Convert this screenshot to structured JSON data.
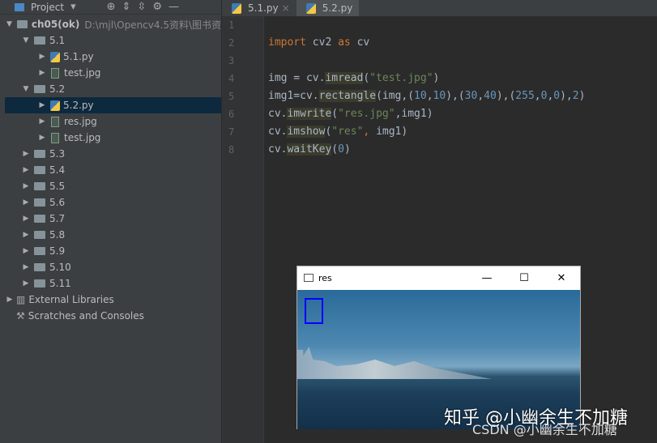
{
  "project_panel": {
    "title": "Project",
    "icons": [
      "locate-icon",
      "expand-all-icon",
      "collapse-all-icon",
      "gear-icon",
      "minimize-icon"
    ],
    "tree": [
      {
        "label": "ch05(ok)",
        "path": "D:\\mjl\\Opencv4.5资料\\图书资",
        "type": "folder",
        "depth": 0,
        "open": true
      },
      {
        "label": "5.1",
        "type": "folder",
        "depth": 1,
        "open": true
      },
      {
        "label": "5.1.py",
        "type": "py",
        "depth": 2
      },
      {
        "label": "test.jpg",
        "type": "jpg",
        "depth": 2
      },
      {
        "label": "5.2",
        "type": "folder",
        "depth": 1,
        "open": true
      },
      {
        "label": "5.2.py",
        "type": "py",
        "depth": 2,
        "selected": true
      },
      {
        "label": "res.jpg",
        "type": "jpg",
        "depth": 2
      },
      {
        "label": "test.jpg",
        "type": "jpg",
        "depth": 2
      },
      {
        "label": "5.3",
        "type": "folder",
        "depth": 1
      },
      {
        "label": "5.4",
        "type": "folder",
        "depth": 1
      },
      {
        "label": "5.5",
        "type": "folder",
        "depth": 1
      },
      {
        "label": "5.6",
        "type": "folder",
        "depth": 1
      },
      {
        "label": "5.7",
        "type": "folder",
        "depth": 1
      },
      {
        "label": "5.8",
        "type": "folder",
        "depth": 1
      },
      {
        "label": "5.9",
        "type": "folder",
        "depth": 1
      },
      {
        "label": "5.10",
        "type": "folder",
        "depth": 1
      },
      {
        "label": "5.11",
        "type": "folder",
        "depth": 1
      },
      {
        "label": "External Libraries",
        "type": "lib",
        "depth": 0
      },
      {
        "label": "Scratches and Consoles",
        "type": "scratch",
        "depth": 0,
        "noarrow": true
      }
    ]
  },
  "tabs": [
    {
      "label": "5.1.py",
      "active": false
    },
    {
      "label": "5.2.py",
      "active": true
    }
  ],
  "editor": {
    "lines": [
      [],
      [
        {
          "t": "import",
          "c": "kw"
        },
        {
          "t": " cv2 "
        },
        {
          "t": "as",
          "c": "kw"
        },
        {
          "t": " cv"
        }
      ],
      [],
      [
        {
          "t": "img = cv."
        },
        {
          "t": "imread",
          "c": "fn"
        },
        {
          "t": "("
        },
        {
          "t": "\"test.jpg\"",
          "c": "str"
        },
        {
          "t": ")"
        }
      ],
      [
        {
          "t": "img1=cv."
        },
        {
          "t": "rectangle",
          "c": "fn"
        },
        {
          "t": "(img,("
        },
        {
          "t": "10",
          "c": "num"
        },
        {
          "t": ","
        },
        {
          "t": "10",
          "c": "num"
        },
        {
          "t": "),("
        },
        {
          "t": "30",
          "c": "num"
        },
        {
          "t": ","
        },
        {
          "t": "40",
          "c": "num"
        },
        {
          "t": "),("
        },
        {
          "t": "255",
          "c": "num"
        },
        {
          "t": ","
        },
        {
          "t": "0",
          "c": "num"
        },
        {
          "t": ","
        },
        {
          "t": "0",
          "c": "num"
        },
        {
          "t": "),"
        },
        {
          "t": "2",
          "c": "num"
        },
        {
          "t": ")"
        }
      ],
      [
        {
          "t": "cv."
        },
        {
          "t": "imwrite",
          "c": "fn"
        },
        {
          "t": "("
        },
        {
          "t": "\"res.jpg\"",
          "c": "str"
        },
        {
          "t": ",img1)"
        }
      ],
      [
        {
          "t": "cv."
        },
        {
          "t": "imshow",
          "c": "fn"
        },
        {
          "t": "("
        },
        {
          "t": "\"res\"",
          "c": "str"
        },
        {
          "t": ", ",
          "c": "kw"
        },
        {
          "t": "img1)"
        }
      ],
      [
        {
          "t": "cv."
        },
        {
          "t": "waitKey",
          "c": "fn"
        },
        {
          "t": "("
        },
        {
          "t": "0",
          "c": "num"
        },
        {
          "t": ")"
        }
      ]
    ]
  },
  "image_window": {
    "title": "res",
    "minimize": "—",
    "maximize": "☐",
    "close": "✕",
    "rect_color": "#0000ff"
  },
  "watermarks": [
    "知乎 @小幽余生不加糖",
    "CSDN @小幽余生不加糖"
  ]
}
